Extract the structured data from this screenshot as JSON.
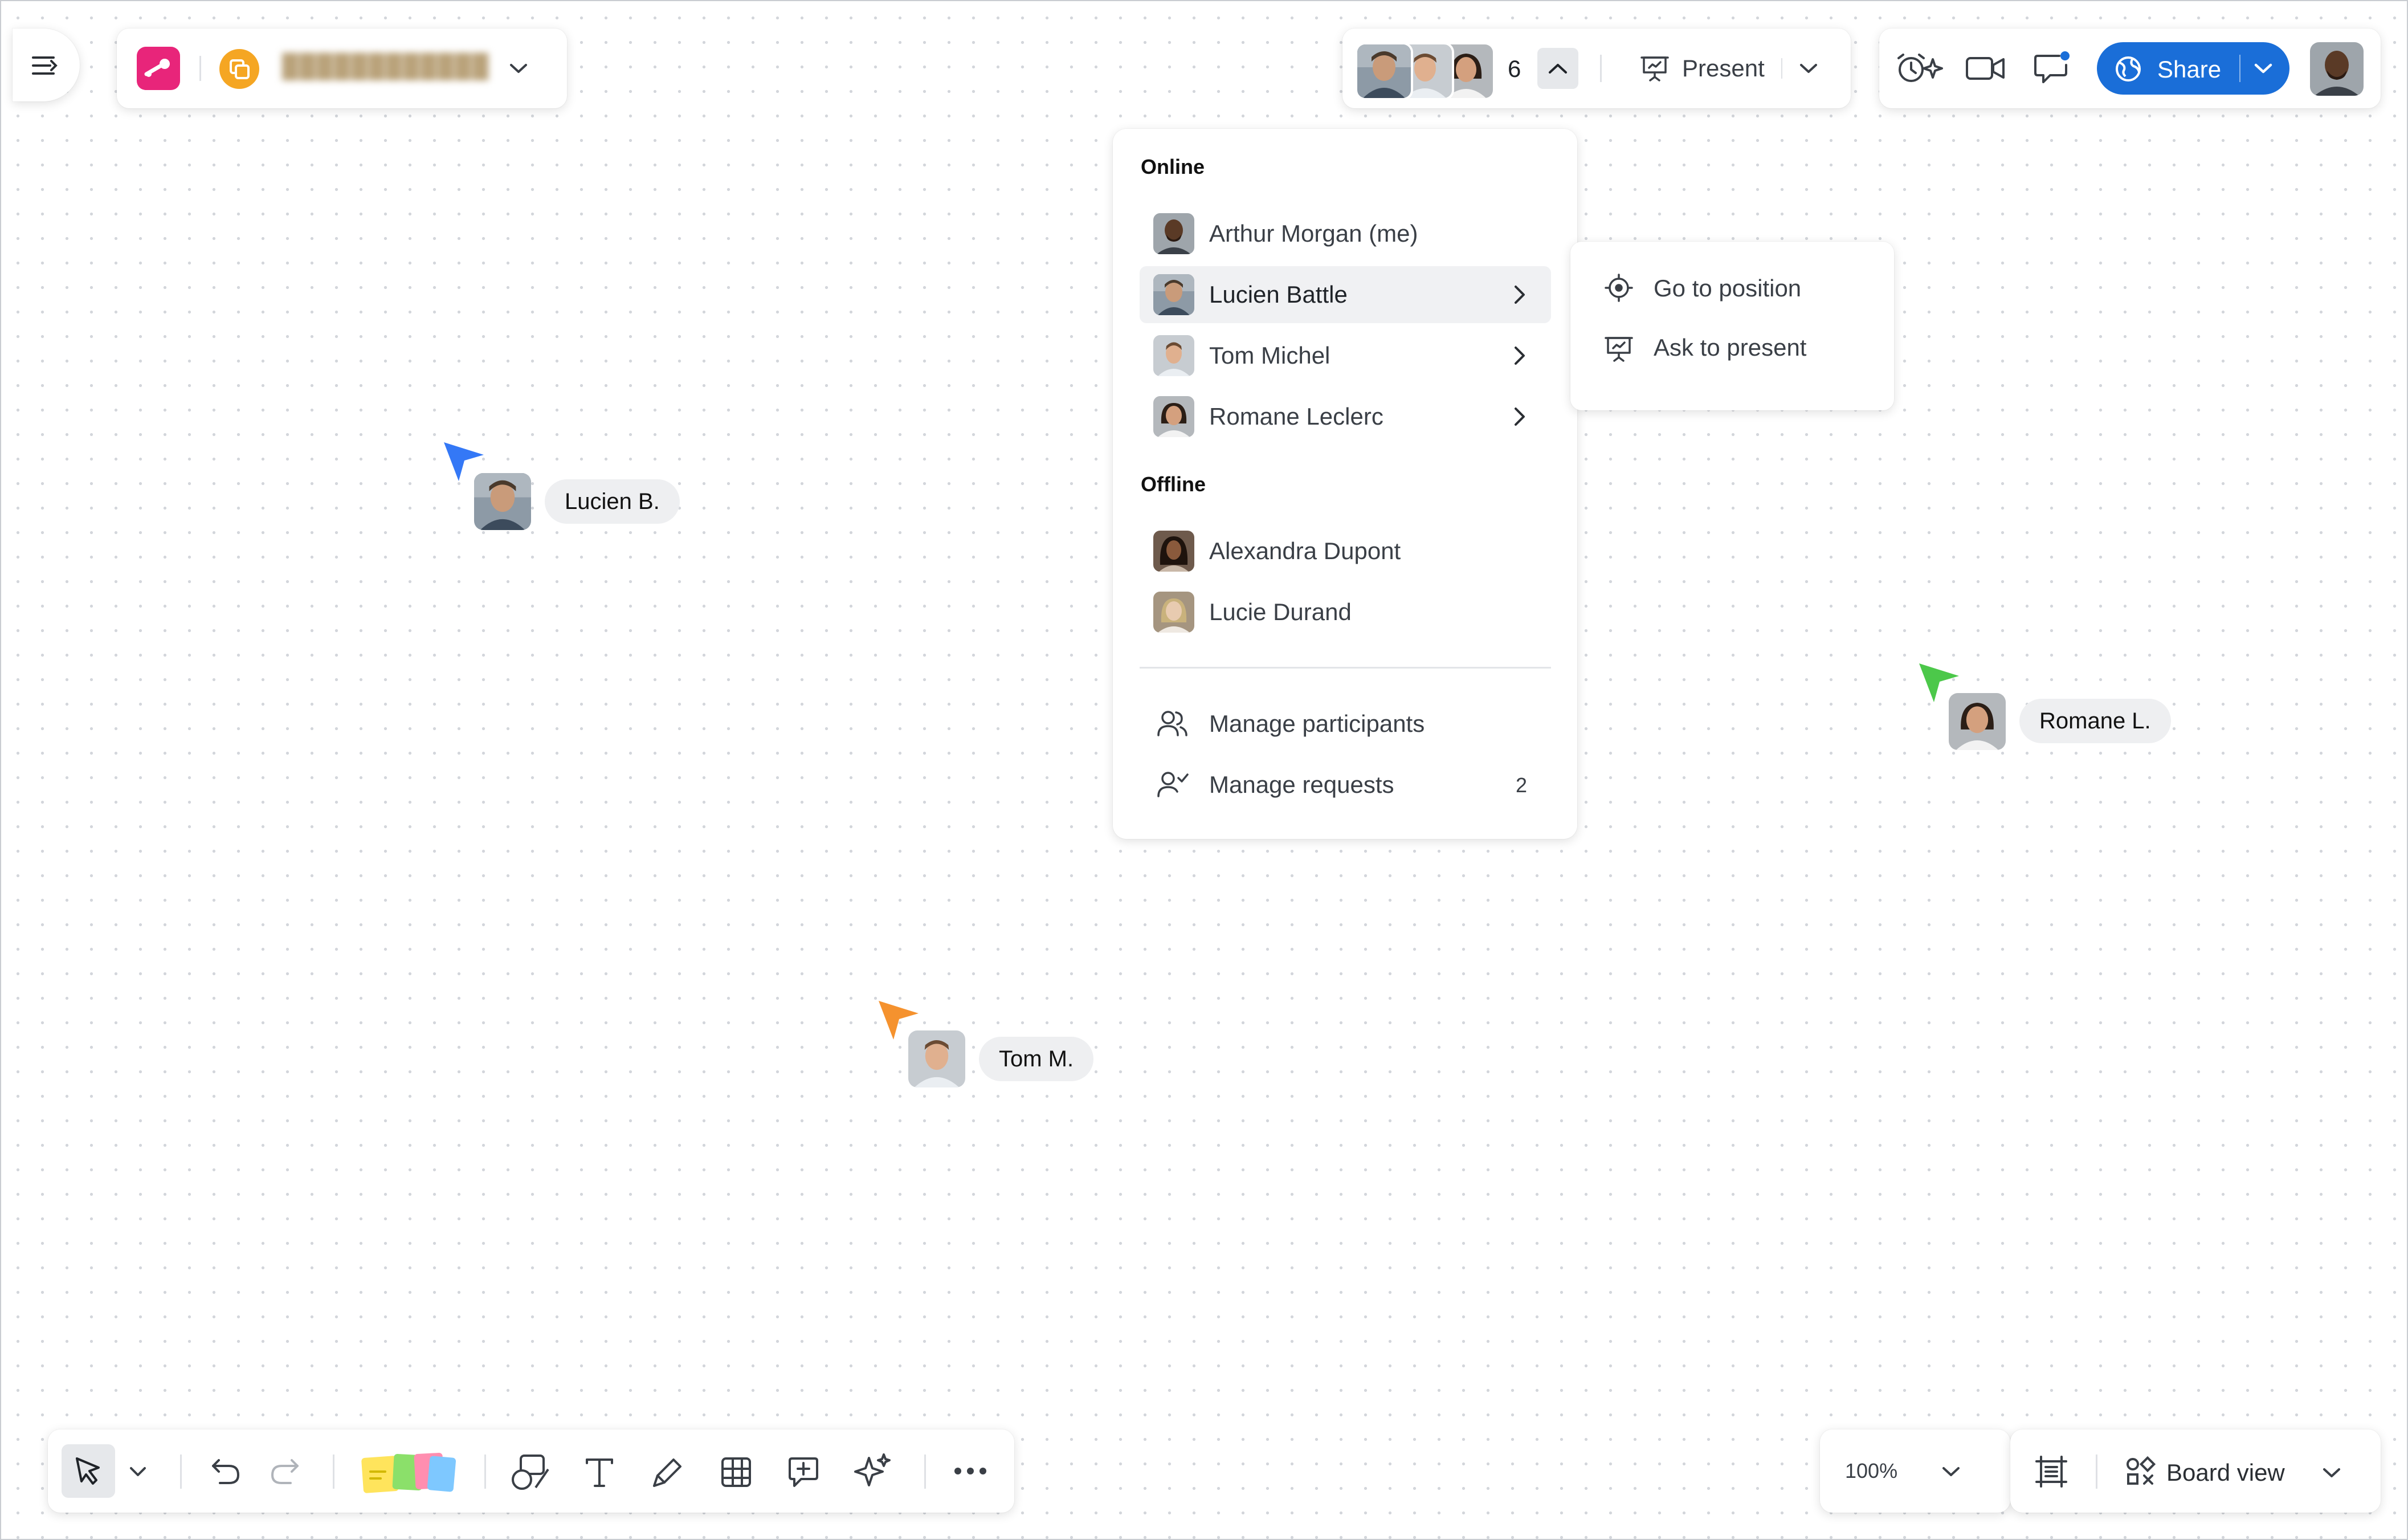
{
  "board": {
    "title_blurred": "████████████",
    "participant_count": "6",
    "present_label": "Present",
    "share_label": "Share"
  },
  "participants_menu": {
    "online_title": "Online",
    "offline_title": "Offline",
    "online": [
      {
        "name": "Arthur Morgan (me)"
      },
      {
        "name": "Lucien Battle"
      },
      {
        "name": "Tom Michel"
      },
      {
        "name": "Romane Leclerc"
      }
    ],
    "offline": [
      {
        "name": "Alexandra Dupont"
      },
      {
        "name": "Lucie Durand"
      }
    ],
    "manage_participants": "Manage participants",
    "manage_requests": "Manage requests",
    "requests_count": "2"
  },
  "submenu": {
    "go_to_position": "Go to position",
    "ask_to_present": "Ask to present"
  },
  "cursors": [
    {
      "label": "Lucien B.",
      "color": "#3478f6"
    },
    {
      "label": "Romane L.",
      "color": "#4cc84a"
    },
    {
      "label": "Tom M.",
      "color": "#f5922e"
    }
  ],
  "bottom": {
    "zoom": "100%",
    "board_view": "Board view"
  },
  "colors": {
    "brand_pink": "#e8257a",
    "accent_orange": "#f5a623",
    "share_blue": "#1a6ed8"
  }
}
